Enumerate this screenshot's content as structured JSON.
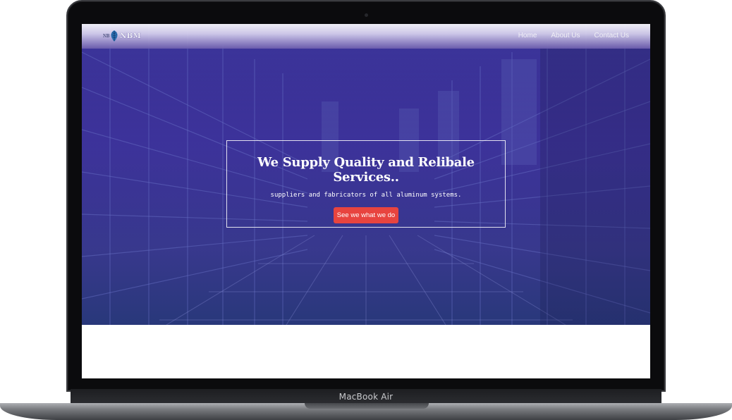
{
  "device": {
    "label": "MacBook Air"
  },
  "navbar": {
    "logo_small": "NB",
    "logo_big": "NBM",
    "links": [
      "Home",
      "About Us",
      "Contact Us"
    ]
  },
  "hero": {
    "title": "We Supply Quality and Relibale Services..",
    "subtitle": "suppliers and fabricators of all aluminum systems.",
    "cta_label": "See we what we do"
  },
  "colors": {
    "overlay": "#3c2a9a",
    "cta": "#e8443f",
    "nav_text": "#ffffff"
  }
}
